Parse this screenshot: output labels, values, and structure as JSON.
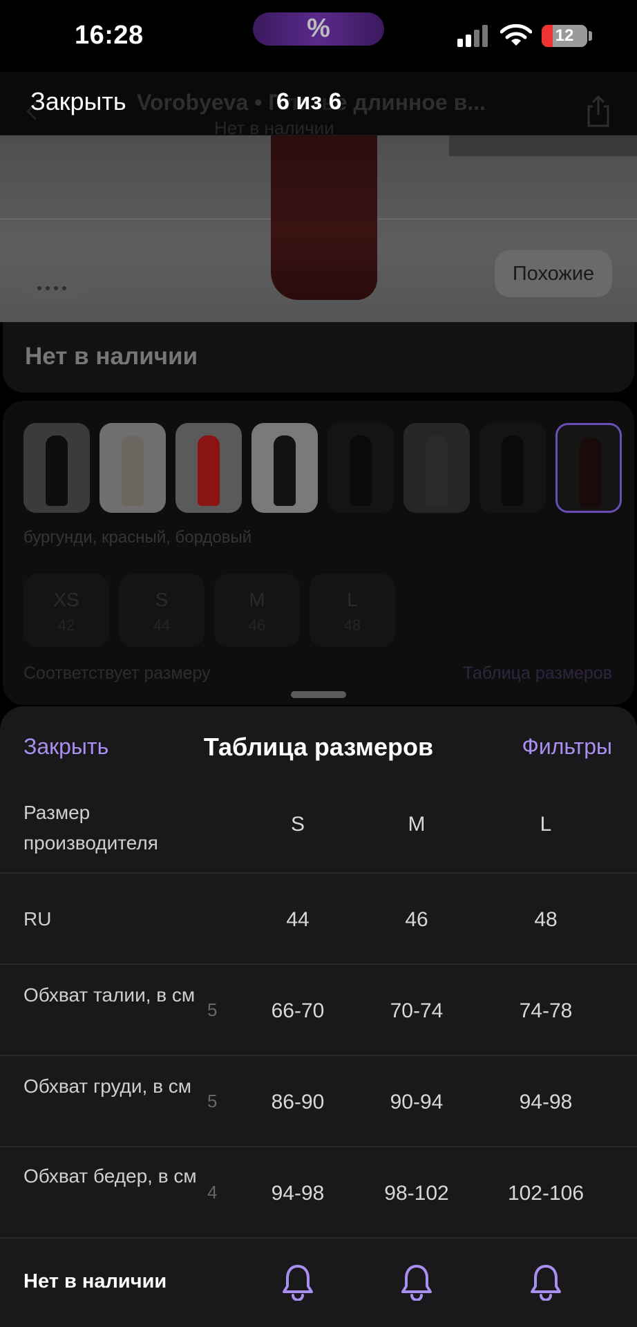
{
  "status_bar": {
    "time": "16:28",
    "island_label": "%",
    "battery_level": "12"
  },
  "viewer": {
    "close_label": "Закрыть",
    "title": "Vorobyeva • Платье длинное в...",
    "subtitle": "Нет в наличии",
    "counter": "6 из 6"
  },
  "photo": {
    "similar_button": "Похожие"
  },
  "product": {
    "stock_status": "Нет в наличии",
    "color_label": "бургунди, красный, бордовый",
    "thumbnails": [
      {
        "figure": "#0d0d0d",
        "bg": "#3b3b3b"
      },
      {
        "figure": "#6b6660",
        "bg": "#6f6f6f"
      },
      {
        "figure": "#8a1414",
        "bg": "#5a5a5a"
      },
      {
        "figure": "#121212",
        "bg": "#7a7a7a"
      },
      {
        "figure": "#0a0a0a",
        "bg": "#141414"
      },
      {
        "figure": "#2a2a2a",
        "bg": "#262626"
      },
      {
        "figure": "#0a0a0a",
        "bg": "#141414"
      },
      {
        "figure": "#1a0b0b",
        "bg": "#151515"
      }
    ],
    "sizes": [
      {
        "size": "XS",
        "ru": "42"
      },
      {
        "size": "S",
        "ru": "44"
      },
      {
        "size": "M",
        "ru": "46"
      },
      {
        "size": "L",
        "ru": "48"
      }
    ],
    "fit_note": "Соответствует размеру",
    "size_table_link": "Таблица размеров"
  },
  "sheet": {
    "close_label": "Закрыть",
    "title": "Таблица размеров",
    "filters_label": "Фильтры",
    "header_label": "Размер производителя",
    "columns": [
      "S",
      "M",
      "L"
    ],
    "rows": [
      {
        "label": "RU",
        "ghost": "",
        "values": [
          "44",
          "46",
          "48"
        ]
      },
      {
        "label": "Обхват талии, в см",
        "ghost": "5",
        "values": [
          "66-70",
          "70-74",
          "74-78"
        ]
      },
      {
        "label": "Обхват груди, в см",
        "ghost": "5",
        "values": [
          "86-90",
          "90-94",
          "94-98"
        ]
      },
      {
        "label": "Обхват бедер, в см",
        "ghost": "4",
        "values": [
          "94-98",
          "98-102",
          "102-106"
        ]
      }
    ],
    "footer_label": "Нет в наличии",
    "bell_icon": "bell-icon",
    "accent_color": "#a98ff0"
  }
}
